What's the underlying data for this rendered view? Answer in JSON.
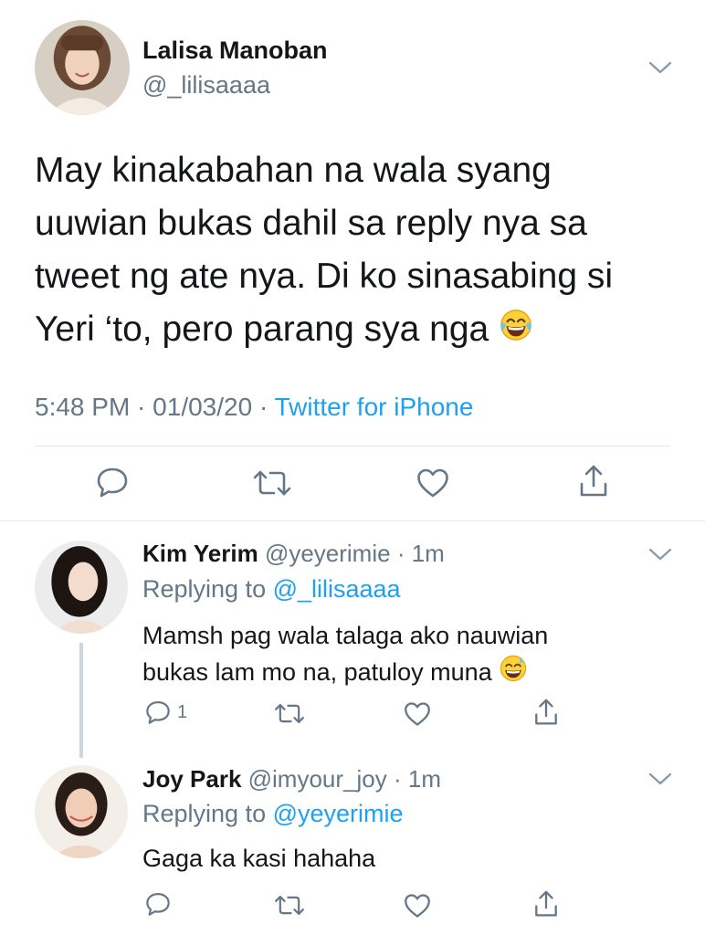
{
  "main_tweet": {
    "author_name": "Lalisa Manoban",
    "handle": "@_lilisaaaa",
    "text_lines": [
      "May kinakabahan na wala syang",
      "uuwian bukas dahil sa reply nya sa",
      "tweet ng ate nya. Di ko sinasabing si",
      "Yeri ‘to, pero parang sya nga"
    ],
    "emoji": "face-with-tears-of-joy",
    "time": "5:48 PM",
    "date": "01/03/20",
    "separator": " · ",
    "source": "Twitter for iPhone"
  },
  "replies": [
    {
      "author_name": "Kim Yerim",
      "handle": "@yeyerimie",
      "age": "1m",
      "replying_label": "Replying to ",
      "replying_to": "@_lilisaaaa",
      "text_lines": [
        "Mamsh pag wala talaga ako nauwian",
        "bukas lam mo na, patuloy muna"
      ],
      "emoji": "smiling-face-with-sweat",
      "reply_count": "1"
    },
    {
      "author_name": "Joy Park",
      "handle": "@imyour_joy",
      "age": "1m",
      "replying_label": "Replying to ",
      "replying_to": "@yeyerimie",
      "text_lines": [
        "Gaga ka kasi hahaha"
      ],
      "reply_count": ""
    }
  ],
  "colors": {
    "text": "#14171a",
    "secondary": "#657786",
    "link": "#1da1f2",
    "divider": "#e1e8ed"
  },
  "icons": [
    "reply-icon",
    "retweet-icon",
    "like-icon",
    "share-icon",
    "chevron-down-icon"
  ]
}
